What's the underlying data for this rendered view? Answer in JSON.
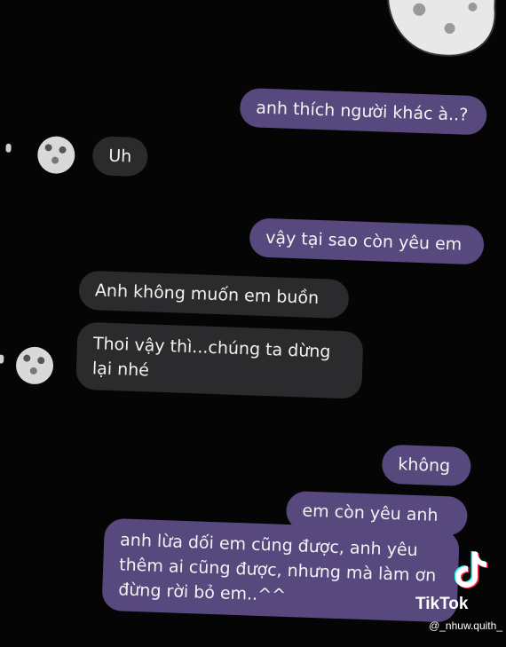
{
  "messages": [
    {
      "text": "anh thích người khác à..?"
    },
    {
      "text": "Uh"
    },
    {
      "text": "vậy tại sao còn yêu em"
    },
    {
      "text": "Anh không muốn em buồn"
    },
    {
      "text": "Thoi vậy thì...chúng ta dừng lại nhé"
    },
    {
      "text": "không"
    },
    {
      "text": "em còn yêu anh"
    },
    {
      "text": "anh lừa dối em cũng được, anh yêu thêm ai cũng được, nhưng mà làm ơn đừng rời bỏ em..^^"
    }
  ],
  "watermark": {
    "brand": "TikTok",
    "handle": "@_nhuw.quith_"
  },
  "colors": {
    "sent_bubble": "#57487e",
    "received_bubble": "#2b2b2d",
    "background": "#050505"
  }
}
